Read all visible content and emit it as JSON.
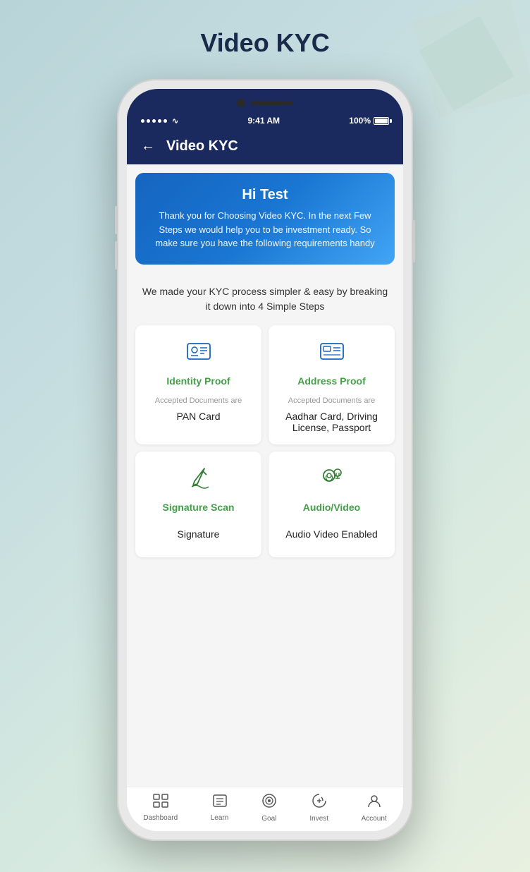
{
  "page": {
    "title": "Video KYC",
    "background_colors": [
      "#b8d4d8",
      "#c5dde0",
      "#d4e8e0",
      "#e8f0e0"
    ]
  },
  "status_bar": {
    "signal_dots": 5,
    "time": "9:41 AM",
    "battery_percent": "100%"
  },
  "header": {
    "back_label": "←",
    "title": "Video KYC"
  },
  "hero": {
    "greeting": "Hi Test",
    "subtitle": "Thank you for Choosing Video KYC. In the next Few Steps we would help you to be investment ready. So make sure you have the following requirements handy"
  },
  "description": "We made your KYC process simpler & easy by breaking it down into 4 Simple Steps",
  "steps": [
    {
      "id": "identity",
      "title": "Identity Proof",
      "accepted_label": "Accepted Documents are",
      "doc_value": "PAN Card",
      "icon": "id-card"
    },
    {
      "id": "address",
      "title": "Address Proof",
      "accepted_label": "Accepted Documents are",
      "doc_value": "Aadhar Card, Driving License, Passport",
      "icon": "address-card"
    },
    {
      "id": "signature",
      "title": "Signature Scan",
      "accepted_label": "",
      "doc_value": "Signature",
      "icon": "pen-signature"
    },
    {
      "id": "audio-video",
      "title": "Audio/Video",
      "accepted_label": "",
      "doc_value": "Audio Video Enabled",
      "icon": "camera-mic"
    }
  ],
  "bottom_nav": [
    {
      "label": "Dashboard",
      "icon": "dashboard"
    },
    {
      "label": "Learn",
      "icon": "learn"
    },
    {
      "label": "Goal",
      "icon": "goal"
    },
    {
      "label": "Invest",
      "icon": "invest"
    },
    {
      "label": "Account",
      "icon": "account"
    }
  ]
}
